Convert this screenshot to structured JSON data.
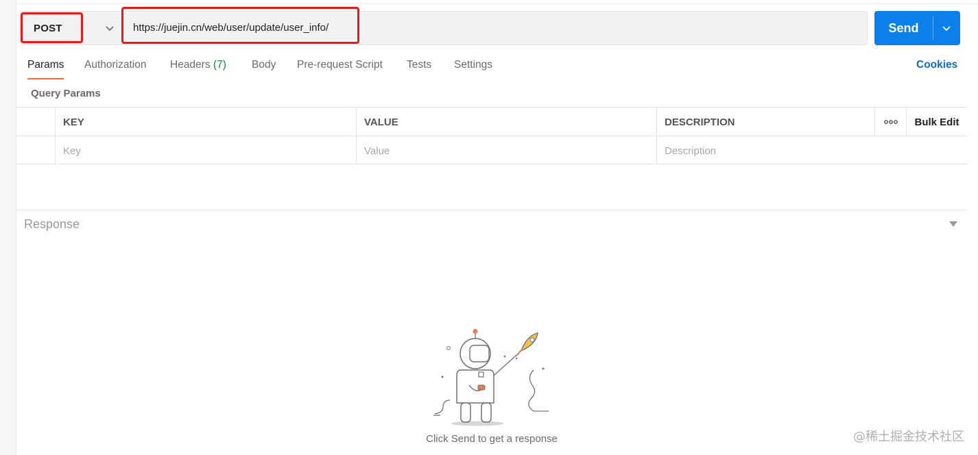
{
  "request": {
    "method": "POST",
    "url": "https://juejin.cn/web/user/update/user_info/",
    "send_label": "Send"
  },
  "tabs": [
    {
      "label": "Params",
      "active": true
    },
    {
      "label": "Authorization"
    },
    {
      "label": "Headers",
      "count": "(7)"
    },
    {
      "label": "Body"
    },
    {
      "label": "Pre-request Script"
    },
    {
      "label": "Tests"
    },
    {
      "label": "Settings"
    }
  ],
  "cookies_label": "Cookies",
  "query_params": {
    "title": "Query Params",
    "columns": [
      "KEY",
      "VALUE",
      "DESCRIPTION"
    ],
    "placeholders": [
      "Key",
      "Value",
      "Description"
    ],
    "bulk_edit_label": "Bulk Edit"
  },
  "response": {
    "title": "Response",
    "empty_message": "Click Send to get a response"
  },
  "watermark": "@稀土掘金技术社区",
  "colors": {
    "send_button": "#0b80ea",
    "active_tab_underline": "#f26b3a",
    "highlight_box": "#e8191b",
    "cookies_link": "#0b6bc7",
    "headers_count": "#1a8b3d"
  },
  "icons": [
    "chevron-down-icon",
    "more-horizontal-icon",
    "caret-down-icon",
    "astronaut-rocket-illustration"
  ]
}
